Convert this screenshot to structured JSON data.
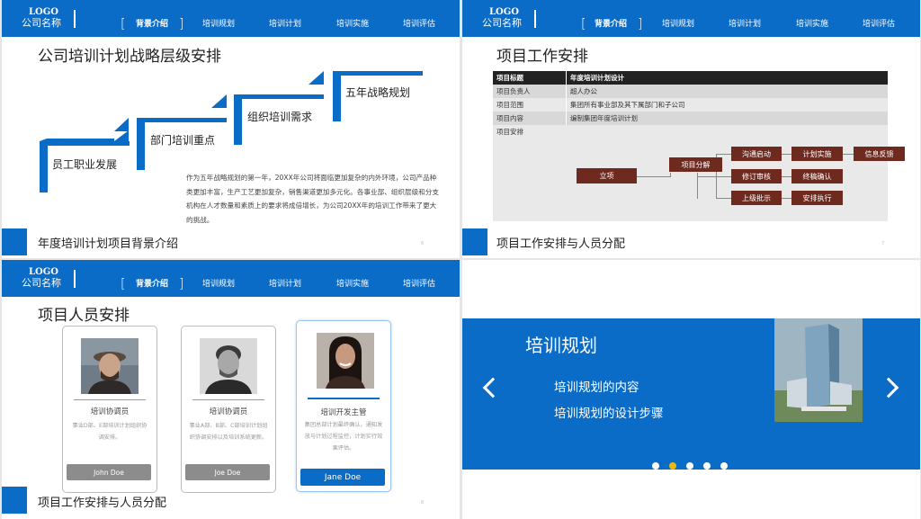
{
  "nav": {
    "logo_top": "LOGO",
    "logo_bottom": "公司名称",
    "items": [
      "背景介绍",
      "培训规划",
      "培训计划",
      "培训实施",
      "培训评估"
    ],
    "active_index": 0
  },
  "slide1": {
    "title": "公司培训计划战略层级安排",
    "steps": [
      "员工职业发展",
      "部门培训重点",
      "组织培训需求",
      "五年战略规划"
    ],
    "paragraph": "作为五年战略规划的第一年，20XX年公司将面临更加复杂的内外环境，公司产品种类更加丰富，生产工艺更加复杂，销售渠道更加多元化。各事业部、组织层级和分支机构在人才数量和素质上的要求将成倍增长，为公司20XX年的培训工作带来了更大的挑战。",
    "footer": "年度培训计划项目背景介绍",
    "page": "6"
  },
  "slide2": {
    "title": "项目工作安排",
    "table": [
      [
        "项目标题",
        "年度培训计划设计"
      ],
      [
        "项目负责人",
        "超人办公"
      ],
      [
        "项目范围",
        "集团所有事业部及其下属部门和子公司"
      ],
      [
        "项目内容",
        "编制集团年度培训计划"
      ]
    ],
    "arrange_label": "项目安排",
    "flow": {
      "start": "立项",
      "split": "项目分解",
      "col1": [
        "沟通启动",
        "修订审核",
        "上级批示"
      ],
      "col2": [
        "计划实施",
        "终稿确认",
        "安排执行"
      ],
      "end": "信息反馈"
    },
    "footer": "项目工作安排与人员分配",
    "page": "7"
  },
  "slide3": {
    "title": "项目人员安排",
    "people": [
      {
        "role": "培训协调员",
        "desc": "事业D部、E部培训计划组织协调安排。",
        "name": "John Doe"
      },
      {
        "role": "培训协调员",
        "desc": "事业A部、B部、C部培训计划组织协调安排以及培训系统更新。",
        "name": "Joe Doe"
      },
      {
        "role": "培训开发主管",
        "desc": "集团总部计划最终确认，通知发放与计划过程监控，计划实行效果评估。",
        "name": "Jane Doe"
      }
    ],
    "footer": "项目工作安排与人员分配",
    "page": "8"
  },
  "slide4": {
    "title": "培训规划",
    "items": [
      "培训规划的内容",
      "培训规划的设计步骤"
    ],
    "active_dot": 1,
    "dot_count": 5
  },
  "colors": {
    "brand_blue": "#0a6cc7",
    "flow_box": "#6e2a1f",
    "active_dot": "#e9b90d"
  }
}
